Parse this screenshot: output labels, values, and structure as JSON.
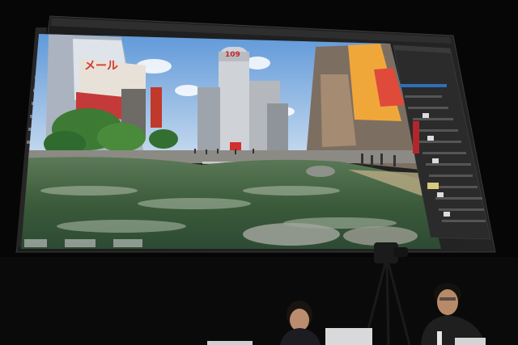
{
  "photo": {
    "subject": "projector-screen-with-photo-editor",
    "menu_items": [],
    "signage": {
      "building_sign": "109",
      "left_billboard": "メール"
    }
  },
  "colors": {
    "sky": "#6fa6e0",
    "water": "#3d5f3e",
    "ui_panel": "#2b2b2b",
    "stage": "#0b0b0b"
  },
  "icons": [
    "laptop-icon",
    "camera-icon",
    "microphone-icon"
  ]
}
